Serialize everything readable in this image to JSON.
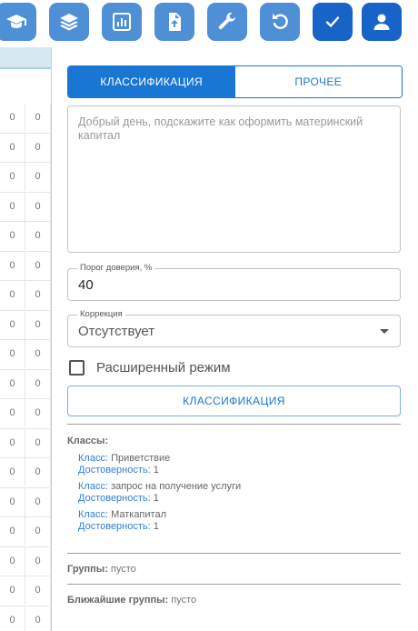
{
  "toolbar": {
    "buttons": [
      {
        "icon": "graduation-cap-icon",
        "style": "light"
      },
      {
        "icon": "layers-icon",
        "style": "light"
      },
      {
        "icon": "bar-chart-icon",
        "style": "light"
      },
      {
        "icon": "file-upload-icon",
        "style": "light"
      },
      {
        "icon": "wrench-icon",
        "style": "light"
      },
      {
        "icon": "undo-icon",
        "style": "light"
      },
      {
        "icon": "check-icon",
        "style": "dark"
      },
      {
        "icon": "user-icon",
        "style": "dark"
      }
    ],
    "colors": {
      "light": "#4f8fd6",
      "dark": "#1763c8"
    }
  },
  "left_table": {
    "cell_value": "0"
  },
  "tabs": [
    {
      "label": "КЛАССИФИКАЦИЯ",
      "active": true
    },
    {
      "label": "ПРОЧЕЕ",
      "active": false
    }
  ],
  "query": {
    "text": "Добрый день, подскажите как оформить материнский капитал"
  },
  "confidence": {
    "label": "Порог доверия, %",
    "value": "40"
  },
  "correction": {
    "label": "Коррекция",
    "value": "Отсутствует"
  },
  "extended_mode": {
    "label": "Расширенный режим",
    "checked": false
  },
  "classify_button": {
    "label": "КЛАССИФИКАЦИЯ"
  },
  "results": {
    "title": "Классы:",
    "class_key": "Класс:",
    "confidence_key": "Достоверность:",
    "items": [
      {
        "class": "Приветствие",
        "confidence": "1"
      },
      {
        "class": "запрос на получение услуги",
        "confidence": "1"
      },
      {
        "class": "Маткапитал",
        "confidence": "1"
      }
    ]
  },
  "groups": {
    "label": "Группы:",
    "value": "пусто"
  },
  "nearest_groups": {
    "label": "Ближайшие группы:",
    "value": "пусто"
  },
  "accent_color": "#1976d2"
}
